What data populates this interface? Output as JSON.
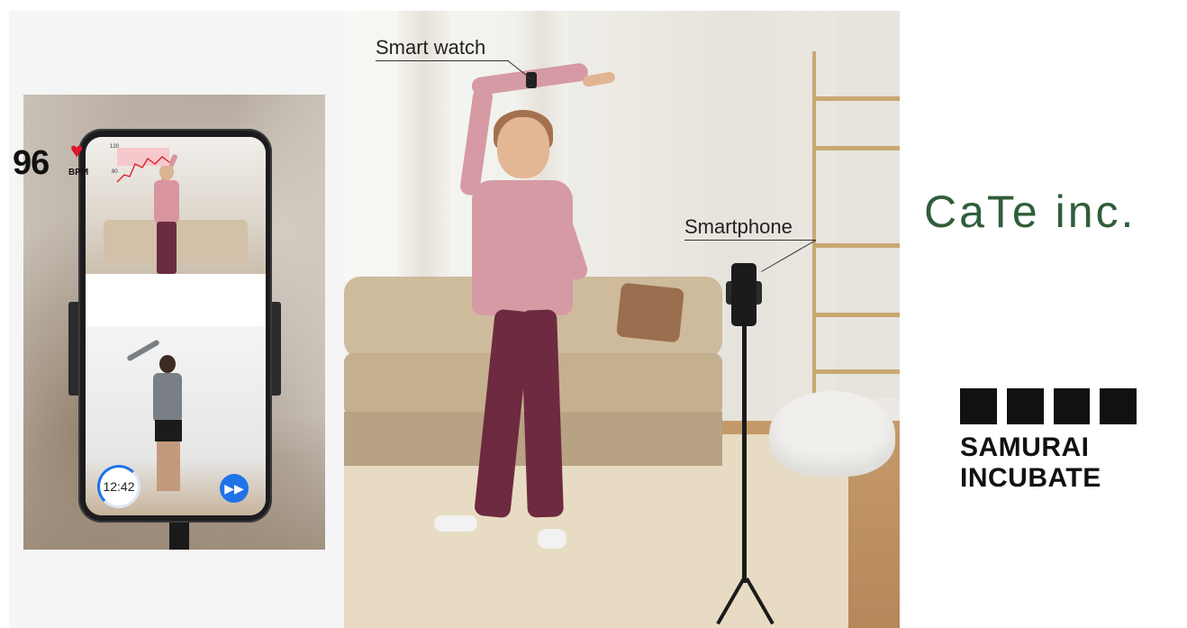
{
  "phone_screen": {
    "heart_rate": "96",
    "heart_unit": "BPM",
    "chart_tick_high": "120",
    "chart_tick_low": "80",
    "timer": "12:42",
    "heart_icon": "heart-icon",
    "forward_icon": "fast-forward-icon"
  },
  "callouts": {
    "watch_label": "Smart watch",
    "phone_label": "Smartphone"
  },
  "logos": {
    "cate": "CaTe inc.",
    "samurai_line1": "SAMURAI",
    "samurai_line2": "INCUBATE"
  },
  "colors": {
    "cate_green": "#2f5e3a",
    "accent_blue": "#1f73e8",
    "heart_red": "#e0152a"
  }
}
